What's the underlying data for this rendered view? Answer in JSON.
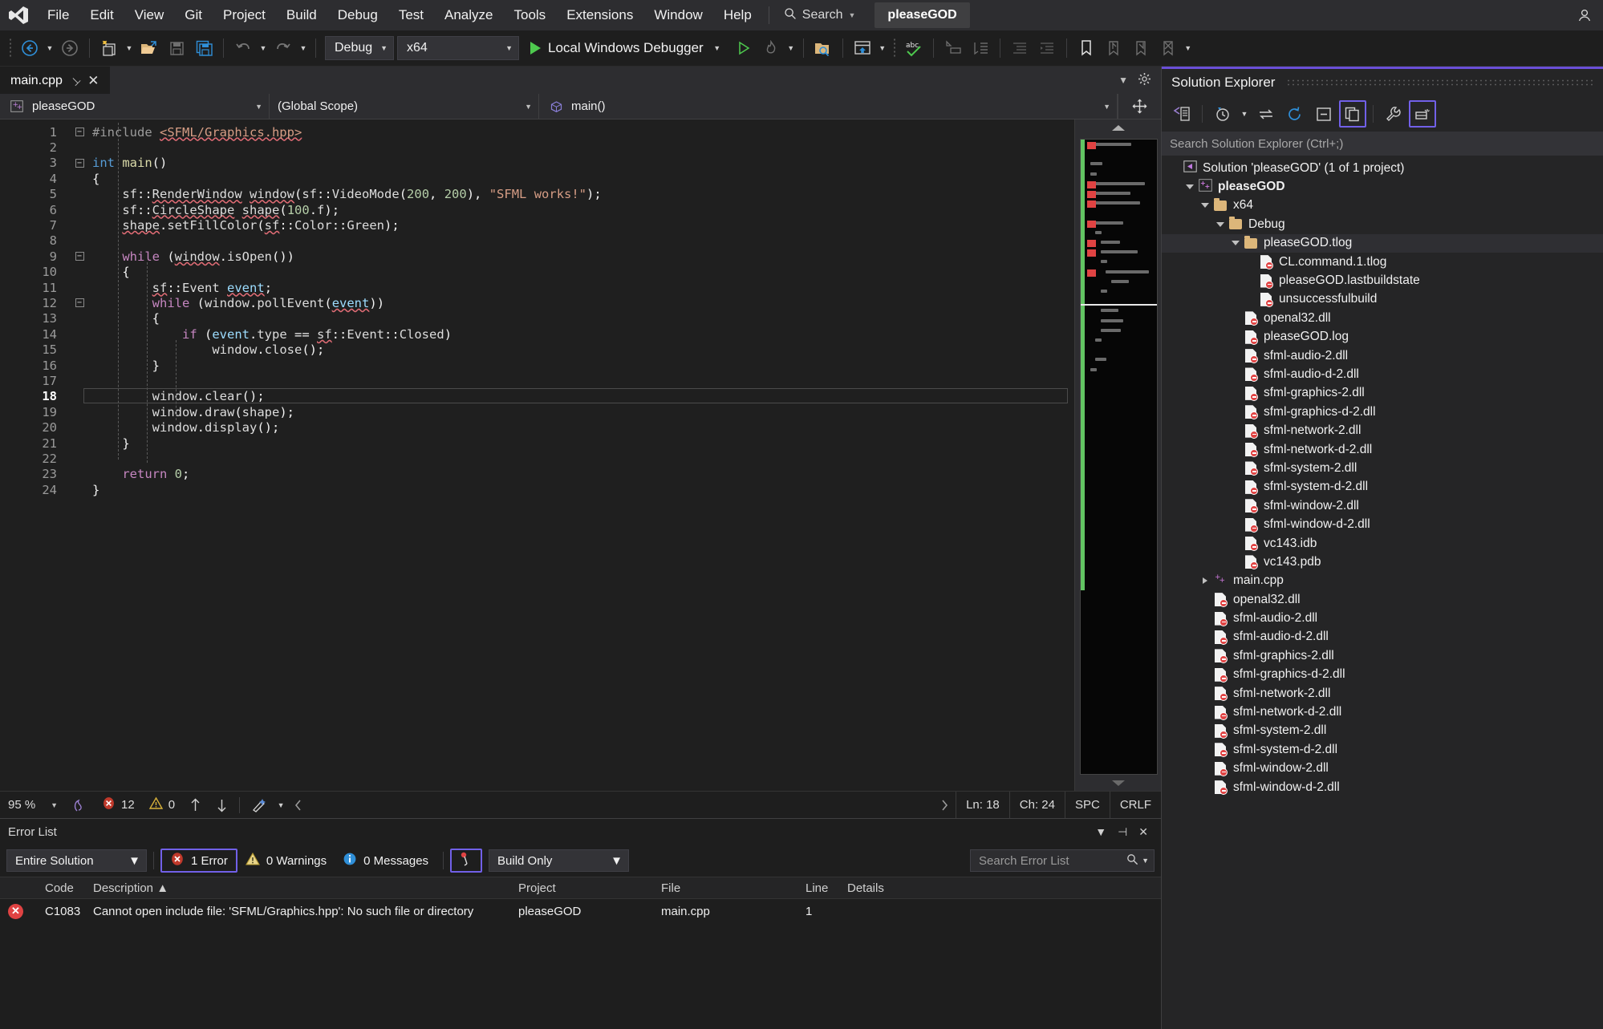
{
  "app": {
    "menu": [
      "File",
      "Edit",
      "View",
      "Git",
      "Project",
      "Build",
      "Debug",
      "Test",
      "Analyze",
      "Tools",
      "Extensions",
      "Window",
      "Help"
    ],
    "search_label": "Search",
    "solution_tab": "pleaseGOD"
  },
  "toolbar": {
    "config": "Debug",
    "platform": "x64",
    "run_label": "Local Windows Debugger"
  },
  "editor": {
    "tab_name": "main.cpp",
    "nav_project": "pleaseGOD",
    "nav_scope": "(Global Scope)",
    "nav_member": "main()",
    "current_line": 18,
    "lines": [
      {
        "n": 1,
        "fold": "minus",
        "html": "<span class='k-pre'>#include</span> <span class='k-str squig'>&lt;SFML/Graphics.hpp&gt;</span>"
      },
      {
        "n": 2,
        "fold": "",
        "html": ""
      },
      {
        "n": 3,
        "fold": "minus",
        "html": "<span class='k-kw'>int</span> <span class='k-fn'>main</span>()"
      },
      {
        "n": 4,
        "fold": "",
        "html": "{"
      },
      {
        "n": 5,
        "fold": "",
        "html": "    <span class='k-pl'>sf</span>::<span class='k-pl squig'>RenderWindow</span> <span class='k-pl squig'>window</span>(<span class='k-pl'>sf</span>::<span class='k-pl'>VideoMode</span>(<span class='k-num'>200</span>, <span class='k-num'>200</span>), <span class='k-str'>\"SFML works!\"</span>);"
      },
      {
        "n": 6,
        "fold": "",
        "html": "    <span class='k-pl'>sf</span>::<span class='k-pl squig'>CircleShape</span> <span class='k-pl squig'>shape</span>(<span class='k-num'>100</span>.<span class='k-pl'>f</span>);"
      },
      {
        "n": 7,
        "fold": "",
        "html": "    <span class='k-pl squig'>shape</span>.<span class='k-pl'>setFillColor</span>(<span class='k-pl squig'>sf</span>::<span class='k-pl'>Color</span>::<span class='k-pl'>Green</span>);"
      },
      {
        "n": 8,
        "fold": "",
        "html": ""
      },
      {
        "n": 9,
        "fold": "minus",
        "html": "    <span class='k-kw2'>while</span> (<span class='k-pl squig'>window</span>.<span class='k-pl'>isOpen</span>())"
      },
      {
        "n": 10,
        "fold": "",
        "html": "    {"
      },
      {
        "n": 11,
        "fold": "",
        "html": "        <span class='k-pl squig'>sf</span>::<span class='k-pl'>Event</span> <span class='k-var squig'>event</span>;"
      },
      {
        "n": 12,
        "fold": "minus",
        "html": "        <span class='k-kw2'>while</span> (<span class='k-pl'>window</span>.<span class='k-pl'>pollEvent</span>(<span class='k-var squig'>event</span>))"
      },
      {
        "n": 13,
        "fold": "",
        "html": "        {"
      },
      {
        "n": 14,
        "fold": "",
        "html": "            <span class='k-kw2'>if</span> (<span class='k-var'>event</span>.<span class='k-pl'>type</span> == <span class='k-pl squig'>sf</span>::<span class='k-pl'>Event</span>::<span class='k-pl'>Closed</span>)"
      },
      {
        "n": 15,
        "fold": "",
        "html": "                <span class='k-pl'>window</span>.<span class='k-pl'>close</span>();"
      },
      {
        "n": 16,
        "fold": "",
        "html": "        }"
      },
      {
        "n": 17,
        "fold": "",
        "html": ""
      },
      {
        "n": 18,
        "fold": "",
        "html": "        <span class='k-pl'>window</span>.<span class='k-pl'>clear</span>();"
      },
      {
        "n": 19,
        "fold": "",
        "html": "        <span class='k-pl'>window</span>.<span class='k-pl'>draw</span>(<span class='k-pl'>shape</span>);"
      },
      {
        "n": 20,
        "fold": "",
        "html": "        <span class='k-pl'>window</span>.<span class='k-pl'>display</span>();"
      },
      {
        "n": 21,
        "fold": "",
        "html": "    }"
      },
      {
        "n": 22,
        "fold": "",
        "html": ""
      },
      {
        "n": 23,
        "fold": "",
        "html": "    <span class='k-kw2'>return</span> <span class='k-num'>0</span>;"
      },
      {
        "n": 24,
        "fold": "",
        "html": "}"
      }
    ]
  },
  "status": {
    "zoom": "95 %",
    "error_count": "12",
    "warning_count": "0",
    "ln": "Ln: 18",
    "ch": "Ch: 24",
    "spc": "SPC",
    "eol": "CRLF"
  },
  "error_list": {
    "title": "Error List",
    "scope": "Entire Solution",
    "errors_chip": "1 Error",
    "warnings_chip": "0 Warnings",
    "messages_chip": "0 Messages",
    "build_filter": "Build Only",
    "search_placeholder": "Search Error List",
    "columns": [
      "",
      "Code",
      "Description ▲",
      "Project",
      "File",
      "Line",
      "Details"
    ],
    "rows": [
      {
        "severity": "error",
        "code": "C1083",
        "description": "Cannot open include file: 'SFML/Graphics.hpp': No such file or directory",
        "project": "pleaseGOD",
        "file": "main.cpp",
        "line": "1",
        "details": ""
      }
    ]
  },
  "solution_explorer": {
    "title": "Solution Explorer",
    "search_placeholder": "Search Solution Explorer (Ctrl+;)",
    "tree": [
      {
        "depth": 0,
        "twisty": "none",
        "icon": "solution-icon",
        "label": "Solution 'pleaseGOD' (1 of 1 project)",
        "bold": false,
        "selected": false
      },
      {
        "depth": 1,
        "twisty": "open",
        "icon": "cpp-project-icon",
        "label": "pleaseGOD",
        "bold": true,
        "selected": false
      },
      {
        "depth": 2,
        "twisty": "open",
        "icon": "folder-icon",
        "label": "x64",
        "bold": false,
        "selected": false
      },
      {
        "depth": 3,
        "twisty": "open",
        "icon": "folder-icon",
        "label": "Debug",
        "bold": false,
        "selected": false
      },
      {
        "depth": 4,
        "twisty": "open",
        "icon": "folder-icon",
        "label": "pleaseGOD.tlog",
        "bold": false,
        "selected": true
      },
      {
        "depth": 5,
        "twisty": "none",
        "icon": "file-excluded-icon",
        "label": "CL.command.1.tlog",
        "bold": false,
        "selected": false
      },
      {
        "depth": 5,
        "twisty": "none",
        "icon": "file-excluded-icon",
        "label": "pleaseGOD.lastbuildstate",
        "bold": false,
        "selected": false
      },
      {
        "depth": 5,
        "twisty": "none",
        "icon": "file-excluded-icon",
        "label": "unsuccessfulbuild",
        "bold": false,
        "selected": false
      },
      {
        "depth": 4,
        "twisty": "none",
        "icon": "file-excluded-icon",
        "label": "openal32.dll",
        "bold": false,
        "selected": false
      },
      {
        "depth": 4,
        "twisty": "none",
        "icon": "file-excluded-icon",
        "label": "pleaseGOD.log",
        "bold": false,
        "selected": false
      },
      {
        "depth": 4,
        "twisty": "none",
        "icon": "file-excluded-icon",
        "label": "sfml-audio-2.dll",
        "bold": false,
        "selected": false
      },
      {
        "depth": 4,
        "twisty": "none",
        "icon": "file-excluded-icon",
        "label": "sfml-audio-d-2.dll",
        "bold": false,
        "selected": false
      },
      {
        "depth": 4,
        "twisty": "none",
        "icon": "file-excluded-icon",
        "label": "sfml-graphics-2.dll",
        "bold": false,
        "selected": false
      },
      {
        "depth": 4,
        "twisty": "none",
        "icon": "file-excluded-icon",
        "label": "sfml-graphics-d-2.dll",
        "bold": false,
        "selected": false
      },
      {
        "depth": 4,
        "twisty": "none",
        "icon": "file-excluded-icon",
        "label": "sfml-network-2.dll",
        "bold": false,
        "selected": false
      },
      {
        "depth": 4,
        "twisty": "none",
        "icon": "file-excluded-icon",
        "label": "sfml-network-d-2.dll",
        "bold": false,
        "selected": false
      },
      {
        "depth": 4,
        "twisty": "none",
        "icon": "file-excluded-icon",
        "label": "sfml-system-2.dll",
        "bold": false,
        "selected": false
      },
      {
        "depth": 4,
        "twisty": "none",
        "icon": "file-excluded-icon",
        "label": "sfml-system-d-2.dll",
        "bold": false,
        "selected": false
      },
      {
        "depth": 4,
        "twisty": "none",
        "icon": "file-excluded-icon",
        "label": "sfml-window-2.dll",
        "bold": false,
        "selected": false
      },
      {
        "depth": 4,
        "twisty": "none",
        "icon": "file-excluded-icon",
        "label": "sfml-window-d-2.dll",
        "bold": false,
        "selected": false
      },
      {
        "depth": 4,
        "twisty": "none",
        "icon": "file-excluded-icon",
        "label": "vc143.idb",
        "bold": false,
        "selected": false
      },
      {
        "depth": 4,
        "twisty": "none",
        "icon": "file-excluded-icon",
        "label": "vc143.pdb",
        "bold": false,
        "selected": false
      },
      {
        "depth": 2,
        "twisty": "closed",
        "icon": "cpp-file-icon",
        "label": "main.cpp",
        "bold": false,
        "selected": false
      },
      {
        "depth": 2,
        "twisty": "none",
        "icon": "file-excluded-icon",
        "label": "openal32.dll",
        "bold": false,
        "selected": false
      },
      {
        "depth": 2,
        "twisty": "none",
        "icon": "file-excluded-icon",
        "label": "sfml-audio-2.dll",
        "bold": false,
        "selected": false
      },
      {
        "depth": 2,
        "twisty": "none",
        "icon": "file-excluded-icon",
        "label": "sfml-audio-d-2.dll",
        "bold": false,
        "selected": false
      },
      {
        "depth": 2,
        "twisty": "none",
        "icon": "file-excluded-icon",
        "label": "sfml-graphics-2.dll",
        "bold": false,
        "selected": false
      },
      {
        "depth": 2,
        "twisty": "none",
        "icon": "file-excluded-icon",
        "label": "sfml-graphics-d-2.dll",
        "bold": false,
        "selected": false
      },
      {
        "depth": 2,
        "twisty": "none",
        "icon": "file-excluded-icon",
        "label": "sfml-network-2.dll",
        "bold": false,
        "selected": false
      },
      {
        "depth": 2,
        "twisty": "none",
        "icon": "file-excluded-icon",
        "label": "sfml-network-d-2.dll",
        "bold": false,
        "selected": false
      },
      {
        "depth": 2,
        "twisty": "none",
        "icon": "file-excluded-icon",
        "label": "sfml-system-2.dll",
        "bold": false,
        "selected": false
      },
      {
        "depth": 2,
        "twisty": "none",
        "icon": "file-excluded-icon",
        "label": "sfml-system-d-2.dll",
        "bold": false,
        "selected": false
      },
      {
        "depth": 2,
        "twisty": "none",
        "icon": "file-excluded-icon",
        "label": "sfml-window-2.dll",
        "bold": false,
        "selected": false
      },
      {
        "depth": 2,
        "twisty": "none",
        "icon": "file-excluded-icon",
        "label": "sfml-window-d-2.dll",
        "bold": false,
        "selected": false
      }
    ]
  },
  "colors": {
    "accent_purple": "#6a4fd8",
    "error_red": "#e04343",
    "changebar_green": "#62c462",
    "folder_tan": "#dcb67a"
  }
}
